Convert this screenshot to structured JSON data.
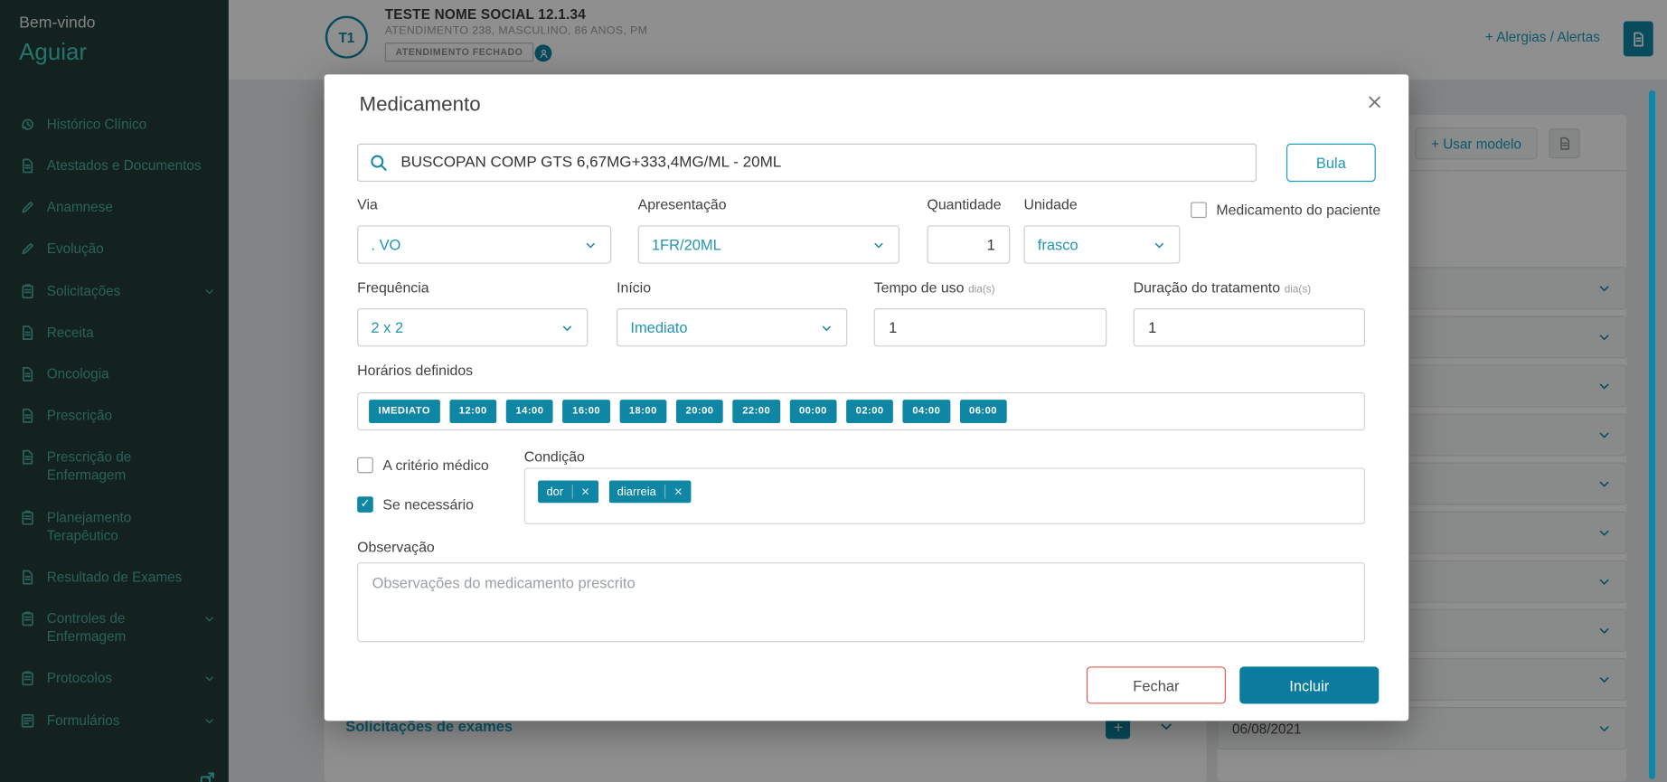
{
  "colors": {
    "primary": "#0e86a4",
    "primary-dark": "#0b7c9e",
    "link": "#1b9cbb",
    "brand": "#43cfc0",
    "sidebar-bg": "#223d38",
    "sidebar-item": "#4fada0",
    "danger": "#e0594f"
  },
  "sidebar": {
    "welcome": "Bem-vindo",
    "username": "Aguiar",
    "items": [
      {
        "label": "Histórico Clínico",
        "icon": "history",
        "chevron": false
      },
      {
        "label": "Atestados e Documentos",
        "icon": "document",
        "chevron": false
      },
      {
        "label": "Anamnese",
        "icon": "pencil",
        "chevron": false
      },
      {
        "label": "Evolução",
        "icon": "pencil",
        "chevron": false
      },
      {
        "label": "Solicitações",
        "icon": "clipboard",
        "chevron": true
      },
      {
        "label": "Receita",
        "icon": "document",
        "chevron": false
      },
      {
        "label": "Oncologia",
        "icon": "document",
        "chevron": false
      },
      {
        "label": "Prescrição",
        "icon": "document",
        "chevron": false
      },
      {
        "label": "Prescrição de Enfermagem",
        "icon": "document",
        "chevron": false
      },
      {
        "label": "Planejamento Terapêutico",
        "icon": "clipboard",
        "chevron": false
      },
      {
        "label": "Resultado de Exames",
        "icon": "document",
        "chevron": false
      },
      {
        "label": "Controles de Enfermagem",
        "icon": "clipboard",
        "chevron": true
      },
      {
        "label": "Protocolos",
        "icon": "clipboard",
        "chevron": true
      },
      {
        "label": "Formulários",
        "icon": "form",
        "chevron": true
      }
    ]
  },
  "header": {
    "avatar_initials": "T1",
    "patient_name": "TESTE NOME SOCIAL 12.1.34",
    "patient_details": "ATENDIMENTO 238, MASCULINO, 86 ANOS, PM",
    "encounter_badge": "ATENDIMENTO FECHADO",
    "allergies_link": "+ Alergias / Alertas"
  },
  "right_panel": {
    "use_model_button": "+ Usar modelo",
    "rows": [
      "",
      "",
      "",
      "",
      "",
      "",
      "",
      "",
      "",
      "06/08/2021"
    ]
  },
  "exams_panel": {
    "title": "Solicitações de exames"
  },
  "modal": {
    "title": "Medicamento",
    "search": {
      "value": "BUSCOPAN COMP GTS 6,67MG+333,4MG/ML - 20ML"
    },
    "bula_button": "Bula",
    "via": {
      "label": "Via",
      "value": ". VO"
    },
    "apresentacao": {
      "label": "Apresentação",
      "value": "1FR/20ML"
    },
    "quantidade": {
      "label": "Quantidade",
      "value": "1"
    },
    "unidade": {
      "label": "Unidade",
      "value": "frasco"
    },
    "medicamento_do_paciente": {
      "label": "Medicamento do paciente",
      "checked": false
    },
    "frequencia": {
      "label": "Frequência",
      "value": "2 x 2"
    },
    "inicio": {
      "label": "Início",
      "value": "Imediato"
    },
    "tempo_de_uso": {
      "label": "Tempo de uso",
      "unit": "dia(s)",
      "value": "1"
    },
    "duracao_tratamento": {
      "label": "Duração do tratamento",
      "unit": "dia(s)",
      "value": "1"
    },
    "horarios": {
      "label": "Horários definidos",
      "chips": [
        "IMEDIATO",
        "12:00",
        "14:00",
        "16:00",
        "18:00",
        "20:00",
        "22:00",
        "00:00",
        "02:00",
        "04:00",
        "06:00"
      ]
    },
    "a_criterio_medico": {
      "label": "A critério médico",
      "checked": false
    },
    "se_necessario": {
      "label": "Se necessário",
      "checked": true
    },
    "condicao": {
      "label": "Condição",
      "tags": [
        "dor",
        "diarreia"
      ]
    },
    "observacao": {
      "label": "Observação",
      "placeholder": "Observações do medicamento prescrito"
    },
    "fechar_button": "Fechar",
    "incluir_button": "Incluir"
  }
}
